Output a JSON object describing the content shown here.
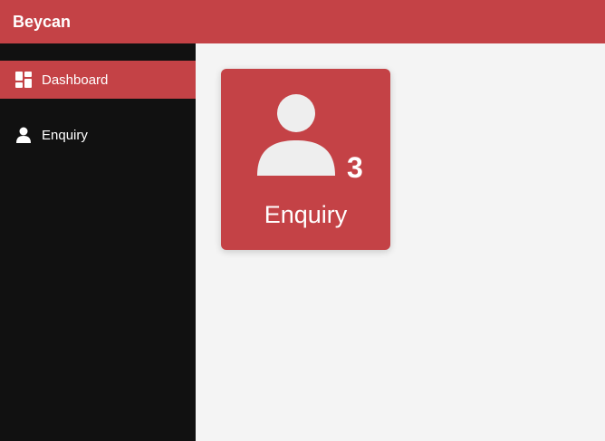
{
  "app": {
    "title": "Beycan"
  },
  "sidebar": {
    "items": [
      {
        "label": "Dashboard",
        "icon": "dashboard-icon",
        "active": true
      },
      {
        "label": "Enquiry",
        "icon": "user-icon",
        "active": false
      }
    ]
  },
  "dashboard": {
    "cards": [
      {
        "label": "Enquiry",
        "count": "3",
        "icon": "user-icon"
      }
    ]
  },
  "colors": {
    "accent": "#c44246",
    "sidebar_bg": "#111111",
    "content_bg": "#f4f4f4",
    "icon_light": "#eeeeee"
  }
}
